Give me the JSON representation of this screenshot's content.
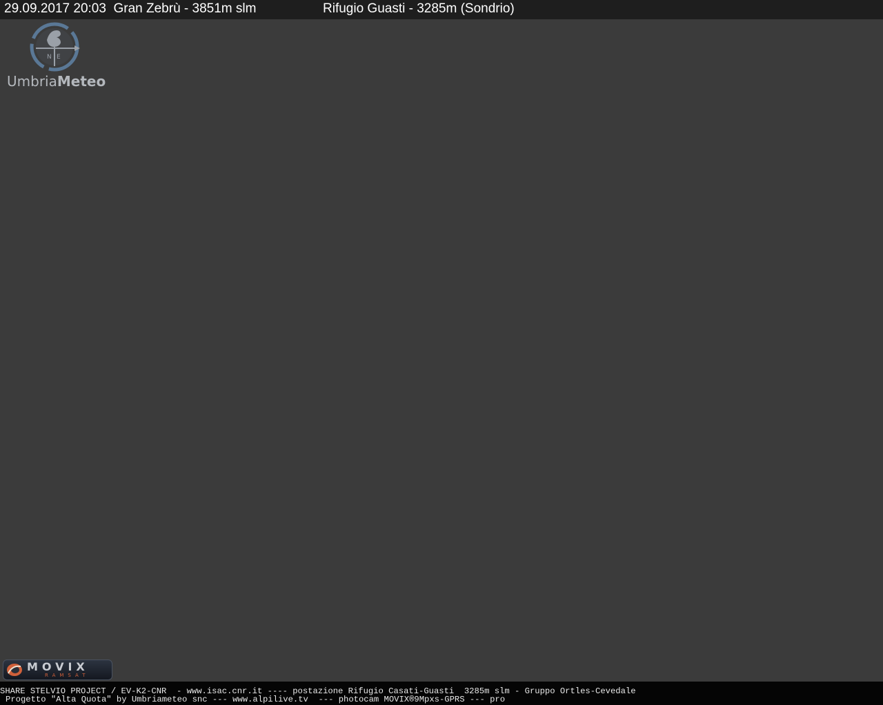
{
  "overlay": {
    "datetime": "29.09.2017 20:03",
    "peak_label": "Gran Zebrù - 3851m slm",
    "station_label": "Rifugio Guasti - 3285m (Sondrio)"
  },
  "logo": {
    "brand_part1": "Umbria",
    "brand_part2": "Meteo",
    "icon": "weathervane-icon"
  },
  "movix_logo": {
    "title": "MOVIX",
    "subtitle": "RAMSAT",
    "icon": "camera-mark-icon"
  },
  "footer": {
    "line1": "SHARE STELVIO PROJECT / EV-K2-CNR  - www.isac.cnr.it ---- postazione Rifugio Casati-Guasti  3285m slm - Gruppo Ortles-Cevedale",
    "line2": "Progetto \"Alta Quota\" by Umbriameteo snc --- www.alpilive.tv  --- photocam MOVIX®9Mpxs-GPRS --- pro"
  },
  "colors": {
    "scene": "#3b3b3b",
    "top_bar": "#1e1e1e",
    "bottom_bar": "#050505",
    "logo_blue": "#5a7896",
    "movix_accent": "#d0603a"
  }
}
